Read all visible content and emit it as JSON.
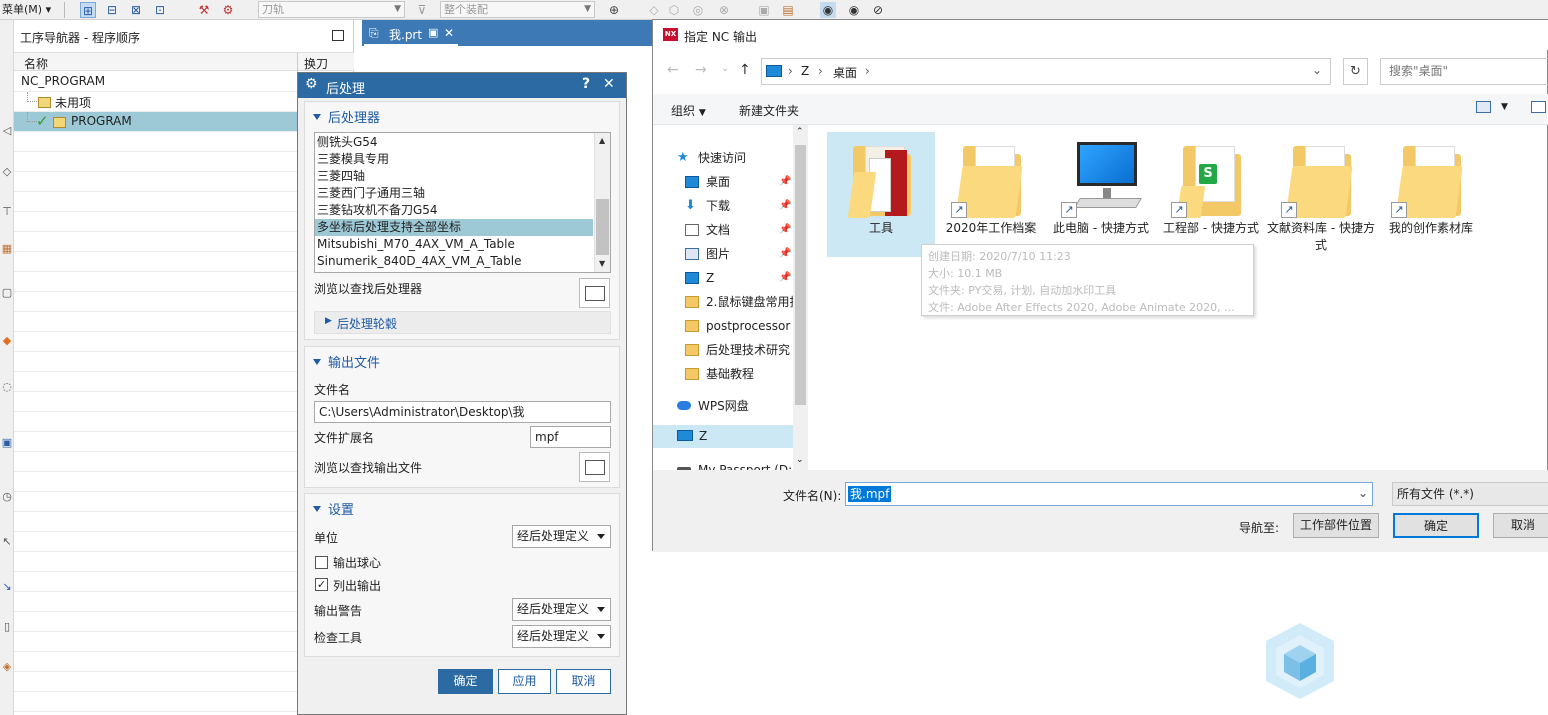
{
  "toolbar": {
    "menu_label": "菜单(M)",
    "menu_arrow": "▾",
    "tool_select": "刀轨",
    "assembly_select": "整个装配"
  },
  "navigator": {
    "title": "工序导航器 - 程序顺序",
    "col_name": "名称",
    "col_tool": "换刀",
    "root": "NC_PROGRAM",
    "unused": "未用项",
    "program": "PROGRAM",
    "check_mark": "✓"
  },
  "graphics_tab": {
    "label": "我.prt",
    "close": "✕"
  },
  "post_dialog": {
    "title": "后处理",
    "help": "?",
    "close": "✕",
    "section_postprocessor": "后处理器",
    "postprocessors": [
      "侧铣头G54",
      "三菱模具专用",
      "三菱四轴",
      "三菱西门子通用三轴",
      "三菱钻攻机不备刀G54",
      "多坐标后处理支持全部坐标",
      "Mitsubishi_M70_4AX_VM_A_Table",
      "Sinumerik_840D_4AX_VM_A_Table"
    ],
    "selected_index": 5,
    "browse_post": "浏览以查找后处理器",
    "post_contour": "后处理轮毂",
    "section_output": "输出文件",
    "filename_label": "文件名",
    "filename_value": "C:\\Users\\Administrator\\Desktop\\我",
    "ext_label": "文件扩展名",
    "ext_value": "mpf",
    "browse_output": "浏览以查找输出文件",
    "section_settings": "设置",
    "unit_label": "单位",
    "unit_value": "经后处理定义",
    "output_ball_label": "输出球心",
    "output_ball_checked": false,
    "list_output_label": "列出输出",
    "list_output_checked": true,
    "check_glyph": "✓",
    "warn_label": "输出警告",
    "warn_value": "经后处理定义",
    "check_tool_label": "检查工具",
    "check_tool_value": "经后处理定义",
    "ok": "确定",
    "apply": "应用",
    "cancel": "取消"
  },
  "file_dialog": {
    "title": "指定 NC 输出",
    "nx_badge": "NX",
    "nav_back": "←",
    "nav_forward": "→",
    "nav_up": "↑",
    "path_separator": "›",
    "path": [
      "Z",
      "桌面"
    ],
    "search_placeholder": "搜索\"桌面\"",
    "organize": "组织",
    "new_folder": "新建文件夹",
    "quick_access": "快速访问",
    "sidebar": [
      {
        "label": "桌面",
        "pinned": true
      },
      {
        "label": "下载",
        "pinned": true
      },
      {
        "label": "文档",
        "pinned": true
      },
      {
        "label": "图片",
        "pinned": true
      },
      {
        "label": "Z",
        "pinned": true
      },
      {
        "label": "2.鼠标键盘常用指",
        "pinned": false
      },
      {
        "label": "postprocessor",
        "pinned": false
      },
      {
        "label": "后处理技术研究",
        "pinned": false
      },
      {
        "label": "基础教程",
        "pinned": false
      }
    ],
    "wps_drive": "WPS网盘",
    "z_drive": "Z",
    "passport": "My Passport (D:",
    "files": [
      {
        "label": "工具",
        "kind": "folder-tools",
        "shortcut": false,
        "selected": true
      },
      {
        "label": "2020年工作档案",
        "kind": "folder",
        "shortcut": true,
        "selected": false
      },
      {
        "label": "此电脑 - 快捷方式",
        "kind": "computer",
        "shortcut": true,
        "selected": false
      },
      {
        "label": "工程部 - 快捷方式",
        "kind": "folder-s",
        "shortcut": true,
        "selected": false
      },
      {
        "label": "文献资料库 - 快捷方式",
        "kind": "folder",
        "shortcut": true,
        "selected": false
      },
      {
        "label": "我的创作素材库",
        "kind": "folder",
        "shortcut": true,
        "selected": false
      }
    ],
    "tooltip": {
      "created": "创建日期: 2020/7/10 11:23",
      "size": "大小: 10.1 MB",
      "folders": "文件夹: PY交易, 计划, 自动加水印工具",
      "files": "文件: Adobe After Effects 2020, Adobe Animate 2020, ..."
    },
    "filename_label": "文件名(N):",
    "filename_value": "我.mpf",
    "filetype": "所有文件 (*.*)",
    "navigate_label": "导航至:",
    "work_part_button": "工作部件位置",
    "ok": "确定",
    "cancel": "取消"
  },
  "colors": {
    "nx_blue": "#2c6aa3",
    "selection": "#9dc9d7",
    "win_accent": "#0078d7"
  }
}
